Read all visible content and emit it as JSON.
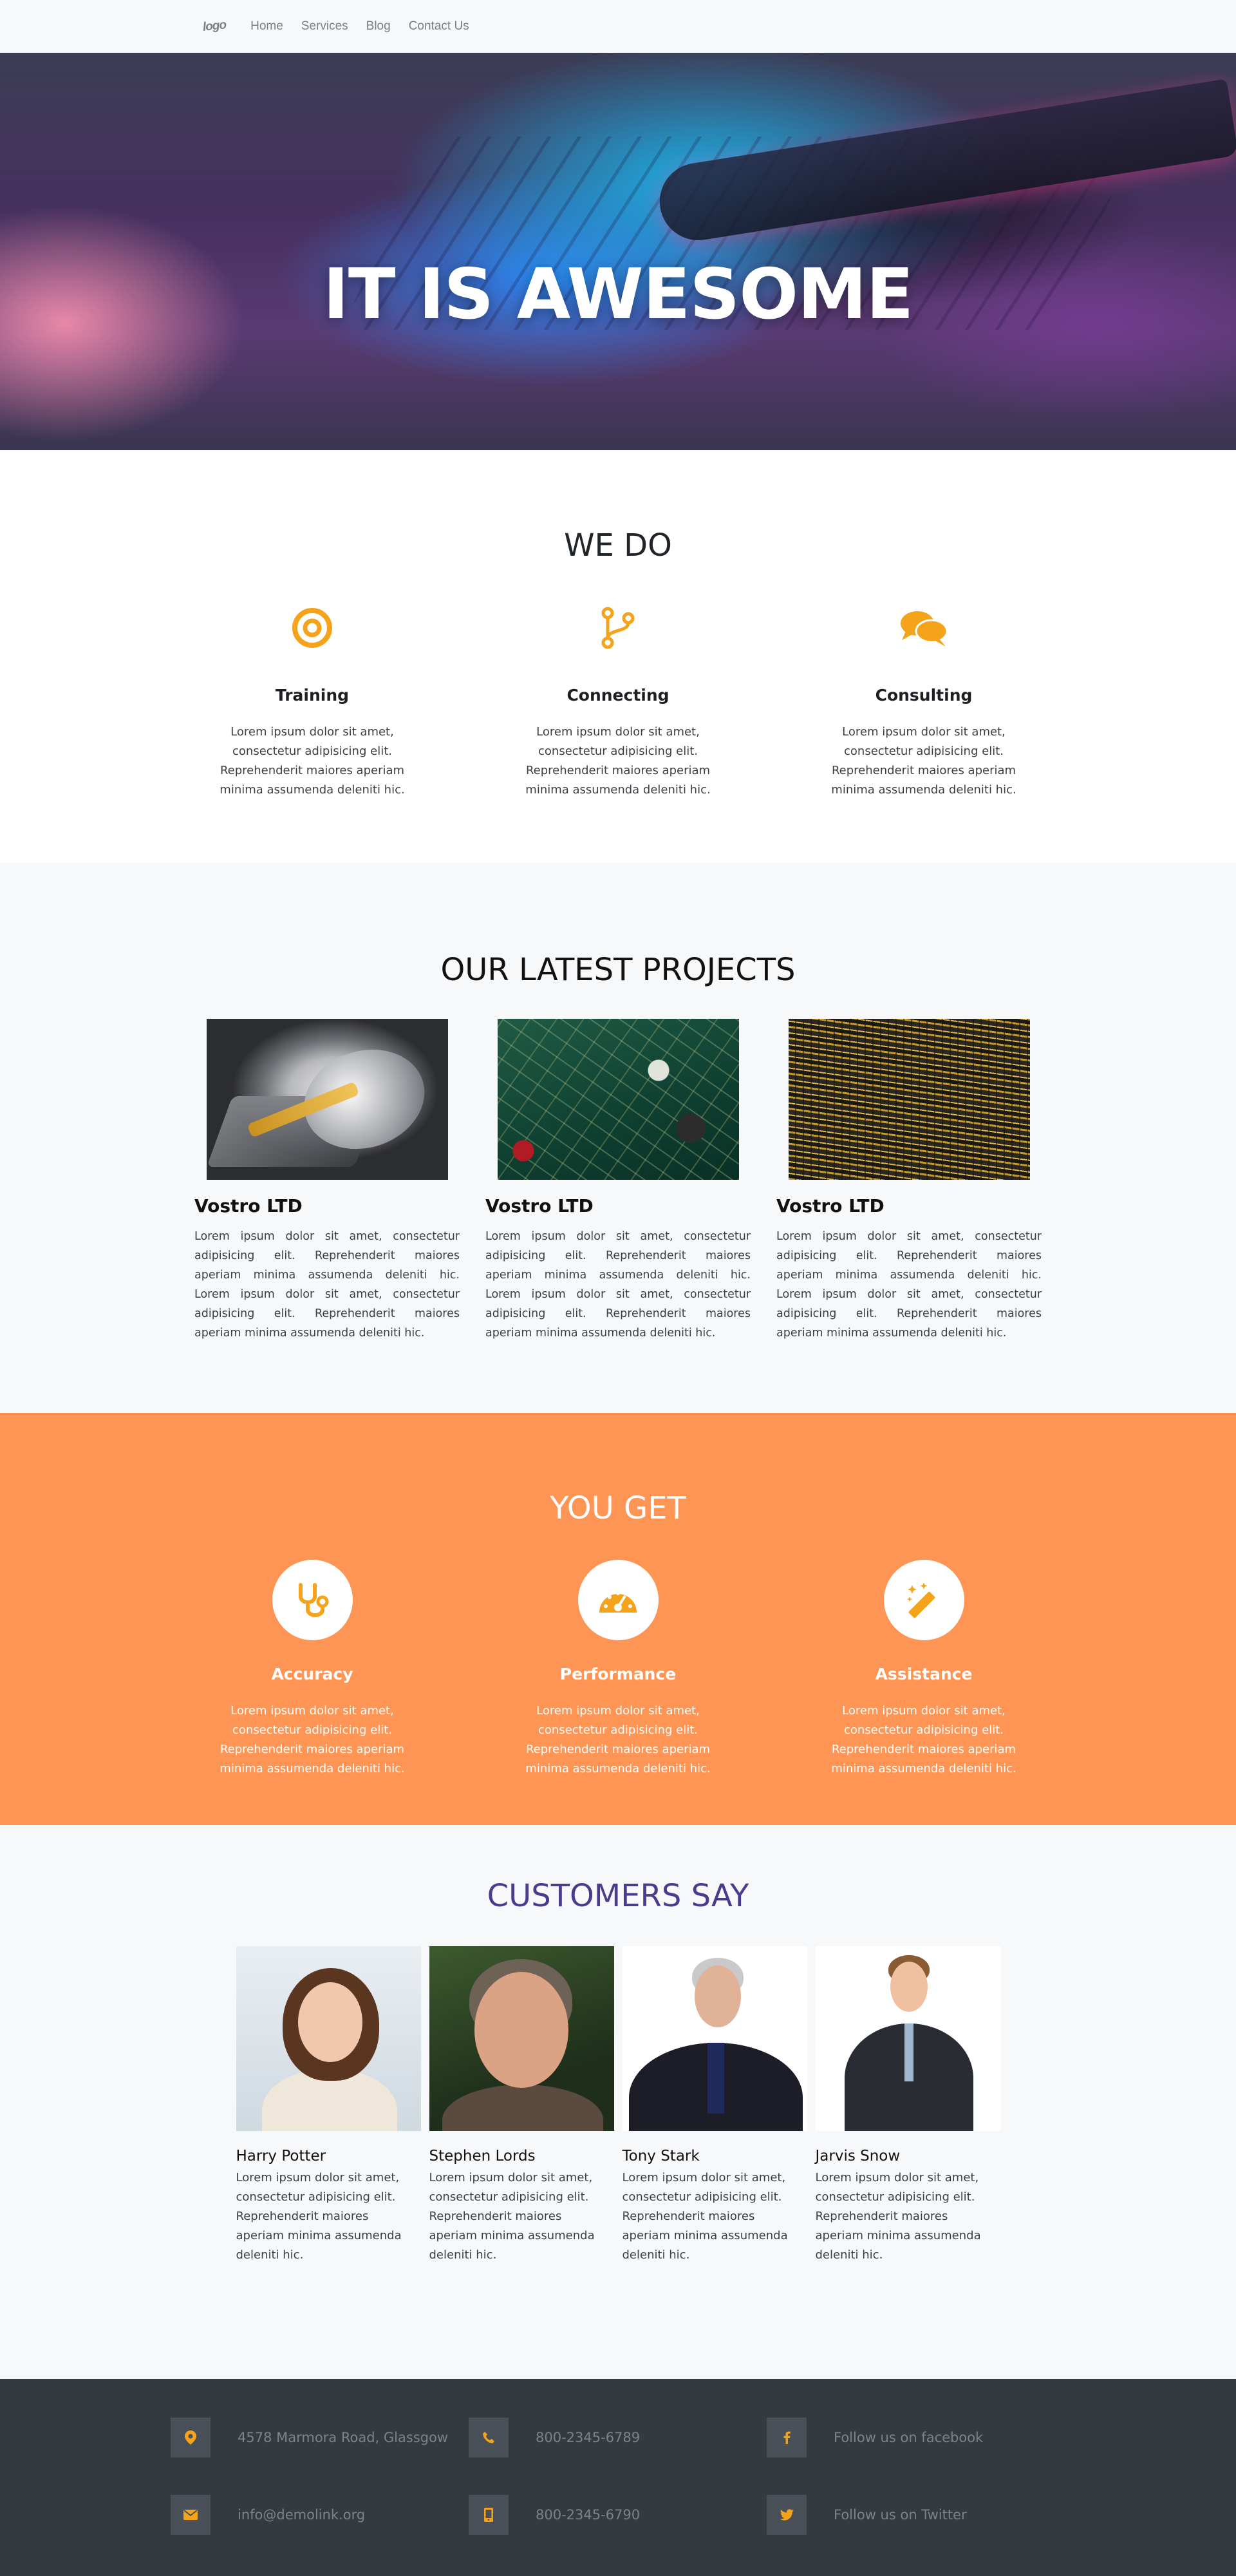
{
  "nav": {
    "logo": "logo",
    "links": [
      "Home",
      "Services",
      "Blog",
      "Contact Us"
    ]
  },
  "hero": {
    "title": "IT IS AWESOME"
  },
  "we_do": {
    "title": "WE DO",
    "items": [
      {
        "icon": "target-icon",
        "title": "Training",
        "text": "Lorem ipsum dolor sit amet, consectetur adipisicing elit. Reprehenderit maiores aperiam minima assumenda deleniti hic."
      },
      {
        "icon": "branch-icon",
        "title": "Connecting",
        "text": "Lorem ipsum dolor sit amet, consectetur adipisicing elit. Reprehenderit maiores aperiam minima assumenda deleniti hic."
      },
      {
        "icon": "chat-icon",
        "title": "Consulting",
        "text": "Lorem ipsum dolor sit amet, consectetur adipisicing elit. Reprehenderit maiores aperiam minima assumenda deleniti hic."
      }
    ]
  },
  "projects": {
    "title": "OUR LATEST PROJECTS",
    "items": [
      {
        "image": "hard-drive",
        "title": "Vostro LTD",
        "text": "Lorem ipsum dolor sit amet, consectetur adipisicing elit. Reprehenderit maiores aperiam minima assumenda deleniti hic. Lorem ipsum dolor sit amet, consectetur adipisicing elit. Reprehenderit maiores aperiam minima assumenda deleniti hic."
      },
      {
        "image": "circuit-board",
        "title": "Vostro LTD",
        "text": "Lorem ipsum dolor sit amet, consectetur adipisicing elit. Reprehenderit maiores aperiam minima assumenda deleniti hic. Lorem ipsum dolor sit amet, consectetur adipisicing elit. Reprehenderit maiores aperiam minima assumenda deleniti hic."
      },
      {
        "image": "network-cables",
        "title": "Vostro LTD",
        "text": "Lorem ipsum dolor sit amet, consectetur adipisicing elit. Reprehenderit maiores aperiam minima assumenda deleniti hic. Lorem ipsum dolor sit amet, consectetur adipisicing elit. Reprehenderit maiores aperiam minima assumenda deleniti hic."
      }
    ]
  },
  "you_get": {
    "title": "YOU GET",
    "items": [
      {
        "icon": "stethoscope-icon",
        "title": "Accuracy",
        "text": "Lorem ipsum dolor sit amet, consectetur adipisicing elit. Reprehenderit maiores aperiam minima assumenda deleniti hic."
      },
      {
        "icon": "speedometer-icon",
        "title": "Performance",
        "text": "Lorem ipsum dolor sit amet, consectetur adipisicing elit. Reprehenderit maiores aperiam minima assumenda deleniti hic."
      },
      {
        "icon": "magic-wand-icon",
        "title": "Assistance",
        "text": "Lorem ipsum dolor sit amet, consectetur adipisicing elit. Reprehenderit maiores aperiam minima assumenda deleniti hic."
      }
    ]
  },
  "customers": {
    "title": "CUSTOMERS SAY",
    "items": [
      {
        "name": "Harry Potter",
        "text": "Lorem ipsum dolor sit amet, consectetur adipisicing elit. Reprehenderit maiores aperiam minima assumenda deleniti hic."
      },
      {
        "name": "Stephen Lords",
        "text": "Lorem ipsum dolor sit amet, consectetur adipisicing elit. Reprehenderit maiores aperiam minima assumenda deleniti hic."
      },
      {
        "name": "Tony Stark",
        "text": "Lorem ipsum dolor sit amet, consectetur adipisicing elit. Reprehenderit maiores aperiam minima assumenda deleniti hic."
      },
      {
        "name": "Jarvis Snow",
        "text": "Lorem ipsum dolor sit amet, consectetur adipisicing elit. Reprehenderit maiores aperiam minima assumenda deleniti hic."
      }
    ]
  },
  "footer": {
    "address": "4578 Marmora Road, Glassgow",
    "phone_1": "800-2345-6789",
    "facebook": "Follow us on facebook",
    "email": "info@demolink.org",
    "phone_2": "800-2345-6790",
    "twitter": "Follow us on Twitter"
  },
  "colors": {
    "accent_orange": "#f5a31a",
    "you_get_bg": "#ff9554",
    "customers_title": "#4a3c8c",
    "footer_bg": "#343a40"
  }
}
